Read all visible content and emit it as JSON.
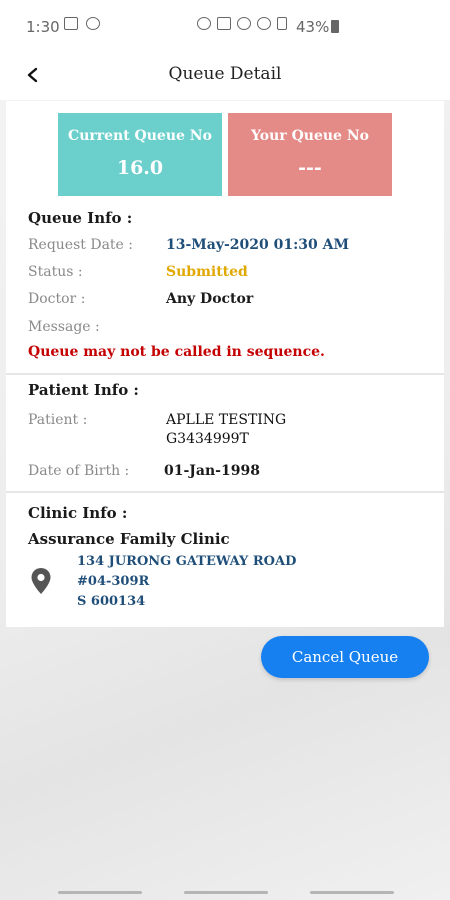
{
  "status_bar": {
    "time": "1:30",
    "battery_pct": "43%"
  },
  "header": {
    "title": "Queue Detail"
  },
  "queue": {
    "current_label": "Current Queue No",
    "current_value": "16.0",
    "yours_label": "Your Queue No",
    "yours_value": "---",
    "current_color": "#6bcfcb",
    "yours_color": "#e48a87"
  },
  "queue_info": {
    "title": "Queue Info :",
    "request_date_label": "Request Date :",
    "request_date_value": "13-May-2020 01:30 AM",
    "status_label": "Status :",
    "status_value": "Submitted",
    "doctor_label": "Doctor :",
    "doctor_value": "Any Doctor",
    "message_label": "Message :",
    "warning": "Queue may not be called in sequence."
  },
  "patient_info": {
    "title": "Patient Info :",
    "patient_label": "Patient :",
    "patient_name": "APLLE TESTING",
    "patient_id": "G3434999T",
    "dob_label": "Date of Birth :",
    "dob_value": "01-Jan-1998"
  },
  "clinic_info": {
    "title": "Clinic Info :",
    "clinic_name": "Assurance Family Clinic",
    "address_line1": "134 JURONG GATEWAY ROAD",
    "address_line2": "#04-309R",
    "address_line3": "S 600134",
    "pin_icon": "location-pin-icon"
  },
  "actions": {
    "cancel_label": "Cancel Queue",
    "accent": "#1680f0"
  }
}
